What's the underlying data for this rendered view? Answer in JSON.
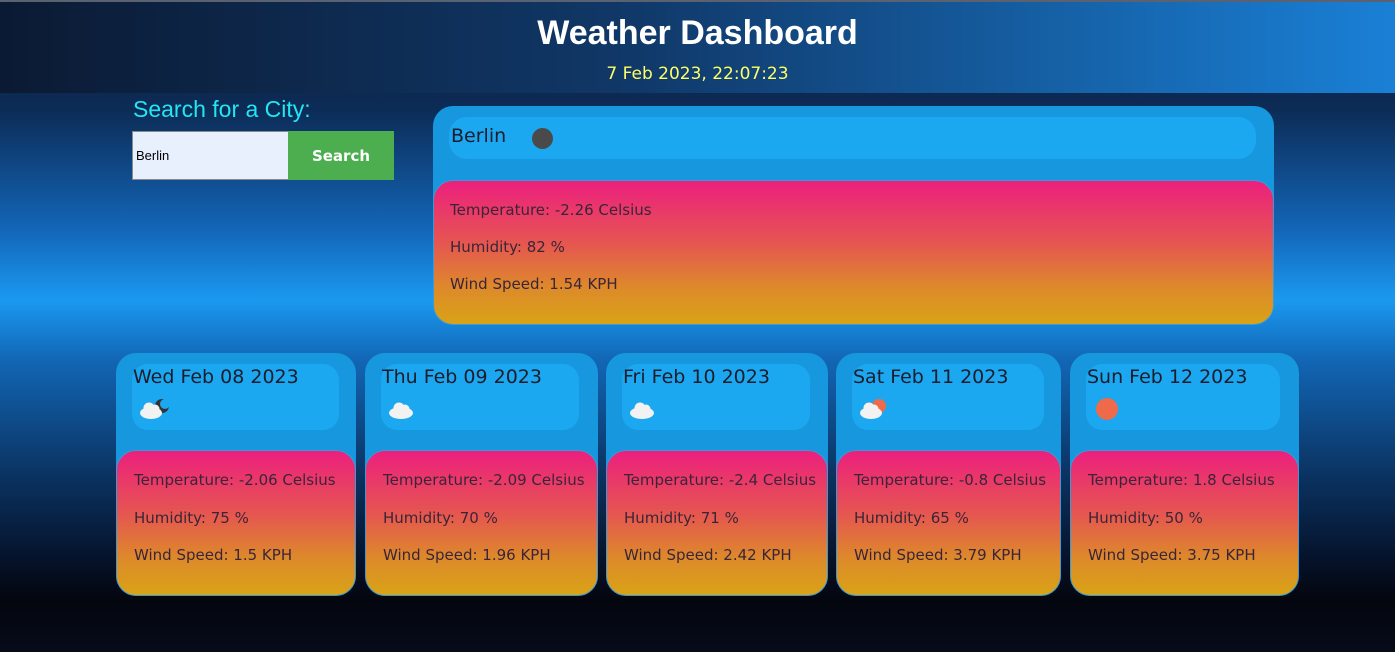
{
  "header": {
    "title": "Weather Dashboard",
    "datetime": "7 Feb 2023, 22:07:23"
  },
  "search": {
    "label": "Search for a City:",
    "value": "Berlin",
    "button_label": "Search"
  },
  "current": {
    "city": "Berlin",
    "icon": "moon-clear-night-icon",
    "temperature": "Temperature: -2.26 Celsius",
    "humidity": "Humidity: 82 %",
    "wind": "Wind Speed: 1.54 KPH"
  },
  "forecast": [
    {
      "date": "Wed Feb 08 2023",
      "icon": "cloud-night-icon",
      "temperature": "Temperature: -2.06 Celsius",
      "humidity": "Humidity: 75 %",
      "wind": "Wind Speed: 1.5 KPH"
    },
    {
      "date": "Thu Feb 09 2023",
      "icon": "cloud-icon",
      "temperature": "Temperature: -2.09 Celsius",
      "humidity": "Humidity: 70 %",
      "wind": "Wind Speed: 1.96 KPH"
    },
    {
      "date": "Fri Feb 10 2023",
      "icon": "cloud-icon",
      "temperature": "Temperature: -2.4 Celsius",
      "humidity": "Humidity: 71 %",
      "wind": "Wind Speed: 2.42 KPH"
    },
    {
      "date": "Sat Feb 11 2023",
      "icon": "cloud-sun-icon",
      "temperature": "Temperature: -0.8 Celsius",
      "humidity": "Humidity: 65 %",
      "wind": "Wind Speed: 3.79 KPH"
    },
    {
      "date": "Sun Feb 12 2023",
      "icon": "sun-icon",
      "temperature": "Temperature: 1.8 Celsius",
      "humidity": "Humidity: 50 %",
      "wind": "Wind Speed: 3.75 KPH"
    }
  ],
  "colors": {
    "accent_cyan": "#22e6f2",
    "clock_yellow": "#ffff66",
    "search_green": "#4cae4f",
    "card_blue": "#1797de",
    "gradient_pink": "#ec1f7e",
    "gradient_amber": "#d9a316"
  }
}
